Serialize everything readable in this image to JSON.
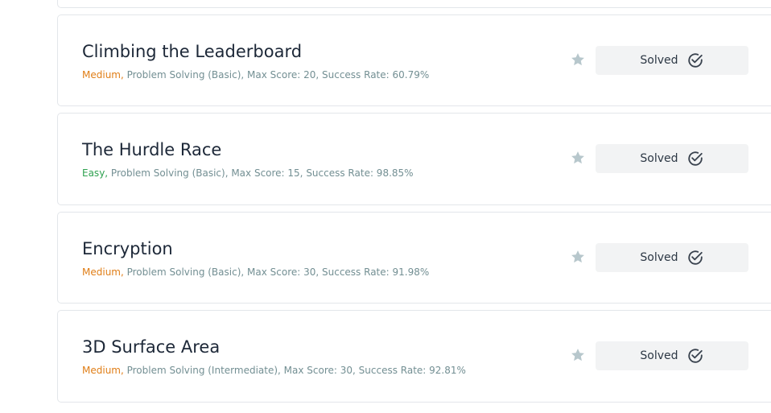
{
  "challenges": [
    {
      "title": "Climbing the Leaderboard",
      "difficulty": "Medium,",
      "details": " Problem Solving (Basic), Max Score: 20, Success Rate: 60.79%",
      "status_label": "Solved"
    },
    {
      "title": "The Hurdle Race",
      "difficulty": "Easy,",
      "details": " Problem Solving (Basic), Max Score: 15, Success Rate: 98.85%",
      "status_label": "Solved"
    },
    {
      "title": "Encryption",
      "difficulty": "Medium,",
      "details": " Problem Solving (Basic), Max Score: 30, Success Rate: 91.98%",
      "status_label": "Solved"
    },
    {
      "title": "3D Surface Area",
      "difficulty": "Medium,",
      "details": " Problem Solving (Intermediate), Max Score: 30, Success Rate: 92.81%",
      "status_label": "Solved"
    }
  ],
  "icons": {
    "bookmark": "star-icon",
    "solved": "check-circle-icon"
  },
  "colors": {
    "medium": "#e07e17",
    "easy": "#2ea14f",
    "meta_text": "#738f93",
    "star": "#b7c7cc",
    "button_bg": "#f2f3f4"
  }
}
